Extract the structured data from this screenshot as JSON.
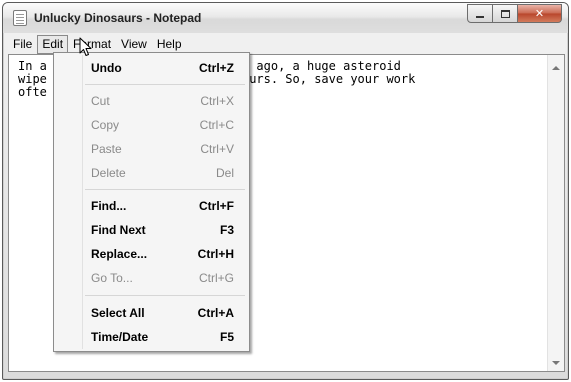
{
  "window": {
    "title": "Unlucky Dinosaurs - Notepad"
  },
  "menubar": {
    "items": [
      "File",
      "Edit",
      "Format",
      "View",
      "Help"
    ],
    "open_item": "Edit"
  },
  "editor": {
    "lines": [
      "In a                   ion years ago, a huge asteroid",
      "wipe                   of dinosaurs. So, save your work",
      "ofte                   in."
    ]
  },
  "edit_menu": {
    "items": [
      {
        "label": "Undo",
        "shortcut": "Ctrl+Z",
        "enabled": true
      },
      {
        "label": "Cut",
        "shortcut": "Ctrl+X",
        "enabled": false
      },
      {
        "label": "Copy",
        "shortcut": "Ctrl+C",
        "enabled": false
      },
      {
        "label": "Paste",
        "shortcut": "Ctrl+V",
        "enabled": false
      },
      {
        "label": "Delete",
        "shortcut": "Del",
        "enabled": false
      },
      {
        "label": "Find...",
        "shortcut": "Ctrl+F",
        "enabled": true
      },
      {
        "label": "Find Next",
        "shortcut": "F3",
        "enabled": true
      },
      {
        "label": "Replace...",
        "shortcut": "Ctrl+H",
        "enabled": true
      },
      {
        "label": "Go To...",
        "shortcut": "Ctrl+G",
        "enabled": false
      },
      {
        "label": "Select All",
        "shortcut": "Ctrl+A",
        "enabled": true
      },
      {
        "label": "Time/Date",
        "shortcut": "F5",
        "enabled": true
      }
    ]
  },
  "icons": {
    "app": "notepad-icon",
    "minimize": "minimize-icon",
    "maximize": "maximize-icon",
    "close": "close-icon",
    "cursor": "mouse-pointer-icon"
  }
}
